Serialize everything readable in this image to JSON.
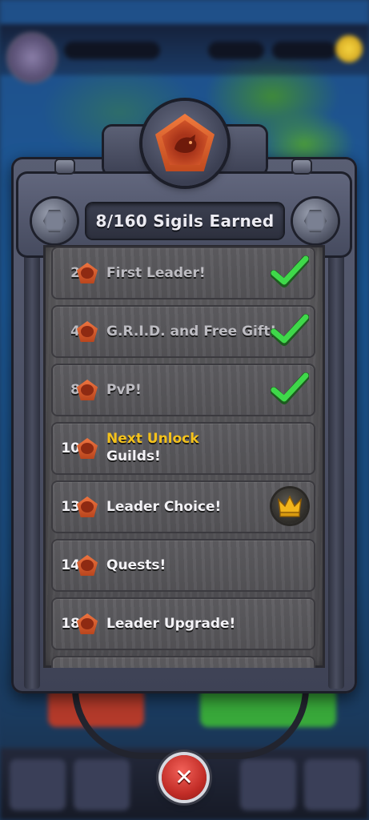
{
  "panel": {
    "title": "8/160 Sigils Earned"
  },
  "milestones": [
    {
      "sigils": "2",
      "label": "First Leader!",
      "status": "completed",
      "icon": "green-checkmark-icon"
    },
    {
      "sigils": "4",
      "label": "G.R.I.D. and Free Gift!",
      "status": "completed",
      "icon": "green-checkmark-icon"
    },
    {
      "sigils": "8",
      "label": "PvP!",
      "status": "completed",
      "icon": "green-checkmark-icon"
    },
    {
      "sigils": "10",
      "next_label": "Next Unlock",
      "label": "Guilds!",
      "status": "next"
    },
    {
      "sigils": "13",
      "label": "Leader Choice!",
      "status": "locked",
      "icon": "gold-crown-icon"
    },
    {
      "sigils": "14",
      "label": "Quests!",
      "status": "locked"
    },
    {
      "sigils": "18",
      "label": "Leader Upgrade!",
      "status": "locked"
    }
  ],
  "colors": {
    "next_unlock": "#f4c21c",
    "check": "#3fd84a",
    "sigil": "#e0602c",
    "close_button": "#d63a32"
  }
}
